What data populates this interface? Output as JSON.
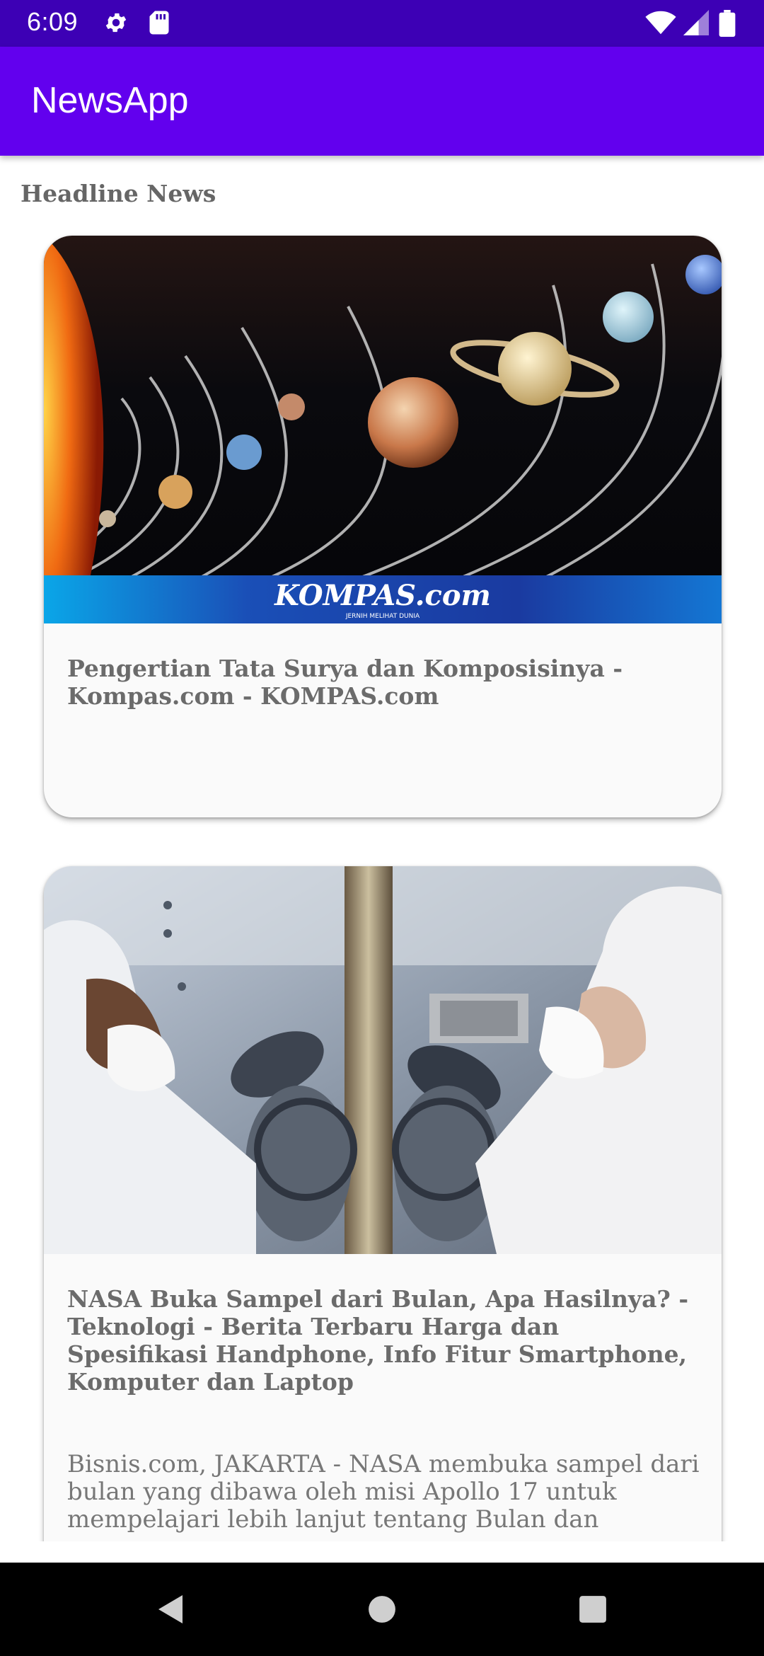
{
  "status_bar": {
    "time": "6:09",
    "icons": [
      "gear-icon",
      "sd-card-icon",
      "wifi-icon",
      "signal-icon",
      "battery-icon"
    ]
  },
  "app_bar": {
    "title": "NewsApp",
    "color": "#6200ee"
  },
  "main": {
    "section_title": "Headline News",
    "articles": [
      {
        "image": "solar-system-image",
        "image_watermark": "KOMPAS.com",
        "image_tagline": "JERNIH MELIHAT DUNIA",
        "title": "Pengertian Tata Surya dan Komposisinya - Kompas.com - KOMPAS.com",
        "description": ""
      },
      {
        "image": "lab-researchers-image",
        "title": "NASA Buka Sampel dari Bulan, Apa Hasilnya? - Teknologi - Berita Terbaru Harga dan Spesifikasi Handphone, Info Fitur Smartphone, Komputer dan Laptop",
        "description": "Bisnis.com, JAKARTA - NASA membuka sampel dari bulan yang dibawa oleh misi Apollo 17 untuk mempelajari lebih lanjut tentang Bulan dan"
      }
    ]
  },
  "nav_bar": {
    "buttons": [
      "back-icon",
      "home-icon",
      "recents-icon"
    ]
  }
}
